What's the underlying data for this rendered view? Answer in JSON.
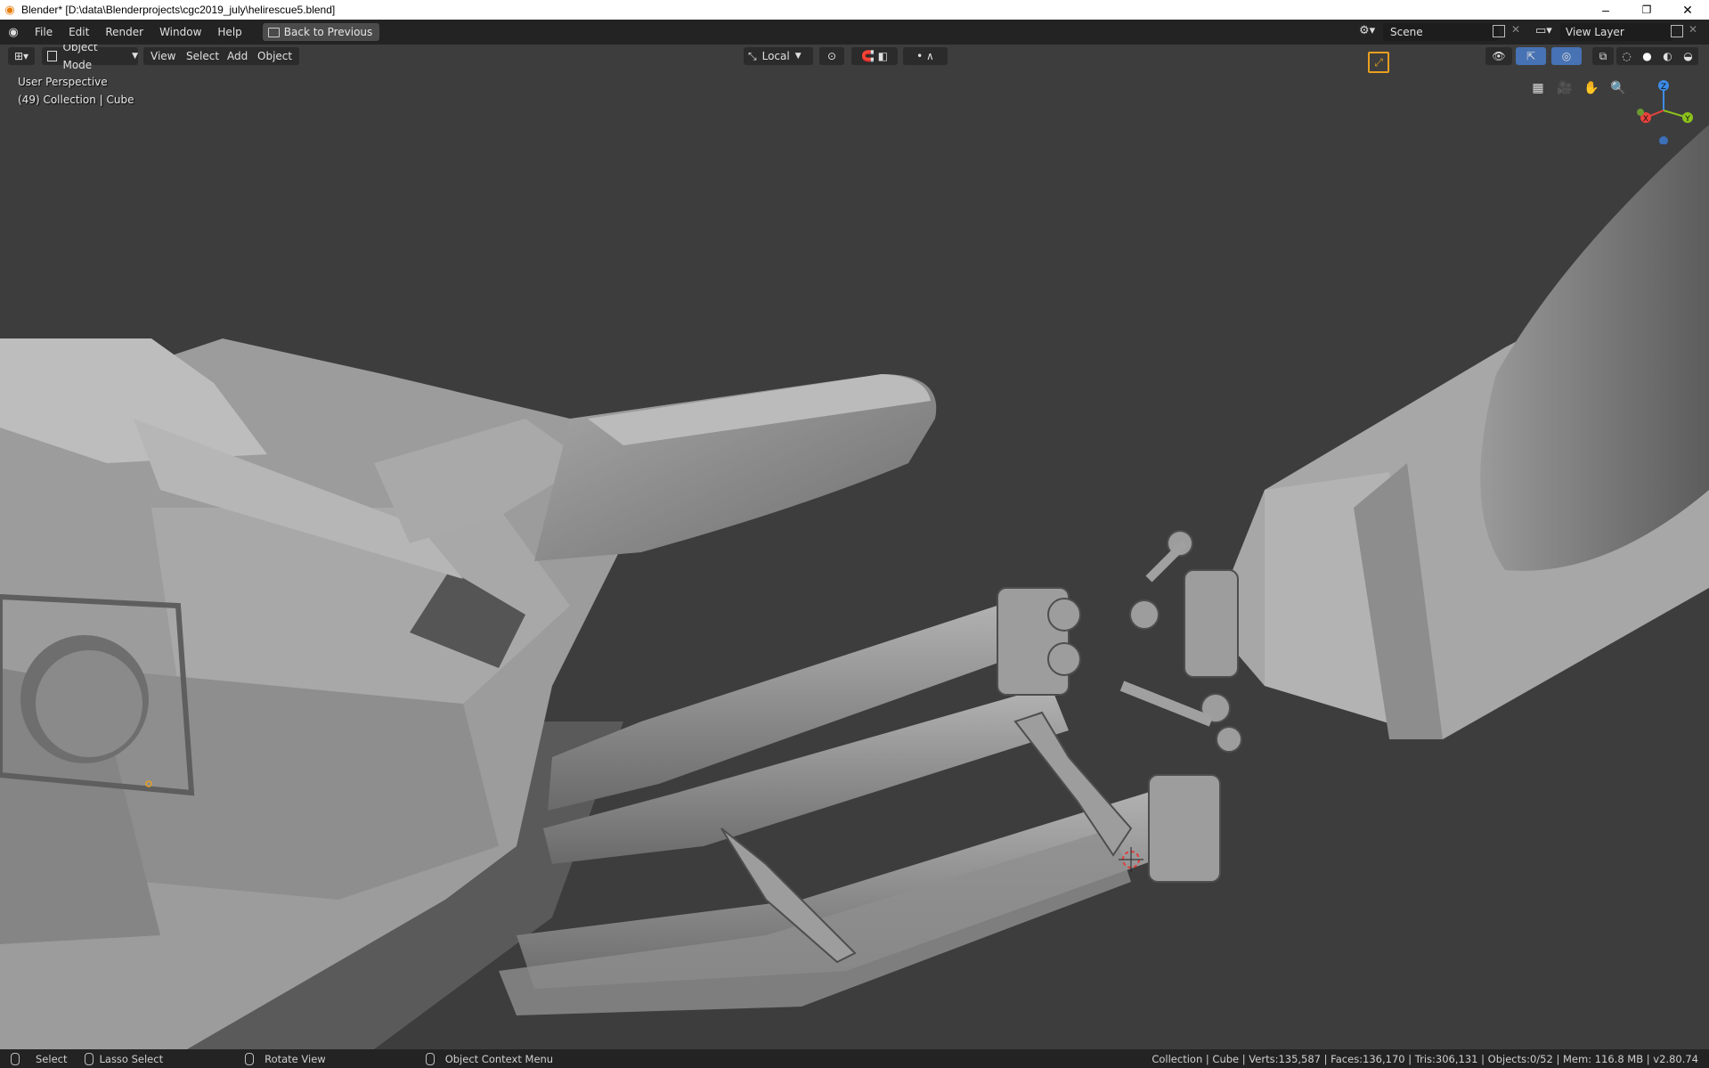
{
  "window": {
    "title": "Blender* [D:\\data\\Blenderprojects\\cgc2019_july\\helirescue5.blend]",
    "minimize": "–",
    "maximize": "❐",
    "close": "✕"
  },
  "topbar": {
    "menus": [
      "File",
      "Edit",
      "Render",
      "Window",
      "Help"
    ],
    "back_label": "Back to Previous",
    "scene_label": "Scene",
    "view_layer_label": "View Layer"
  },
  "header": {
    "mode_label": "Object Mode",
    "menus": [
      "View",
      "Select",
      "Add",
      "Object"
    ],
    "orientation_label": "Local"
  },
  "viewport": {
    "perspective_label": "User Perspective",
    "collection_label": "(49) Collection | Cube",
    "axes": {
      "x": "X",
      "y": "Y",
      "z": "Z"
    },
    "colors": {
      "x": "#e8433c",
      "y": "#8cc21c",
      "z": "#3c8ce8",
      "background": "#3d3d3d"
    }
  },
  "statusbar": {
    "select": "Select",
    "lasso": "Lasso Select",
    "rotate": "Rotate View",
    "context": "Object Context Menu",
    "stats": "Collection | Cube | Verts:135,587 | Faces:136,170 | Tris:306,131 | Objects:0/52 | Mem: 116.8 MB | v2.80.74"
  }
}
